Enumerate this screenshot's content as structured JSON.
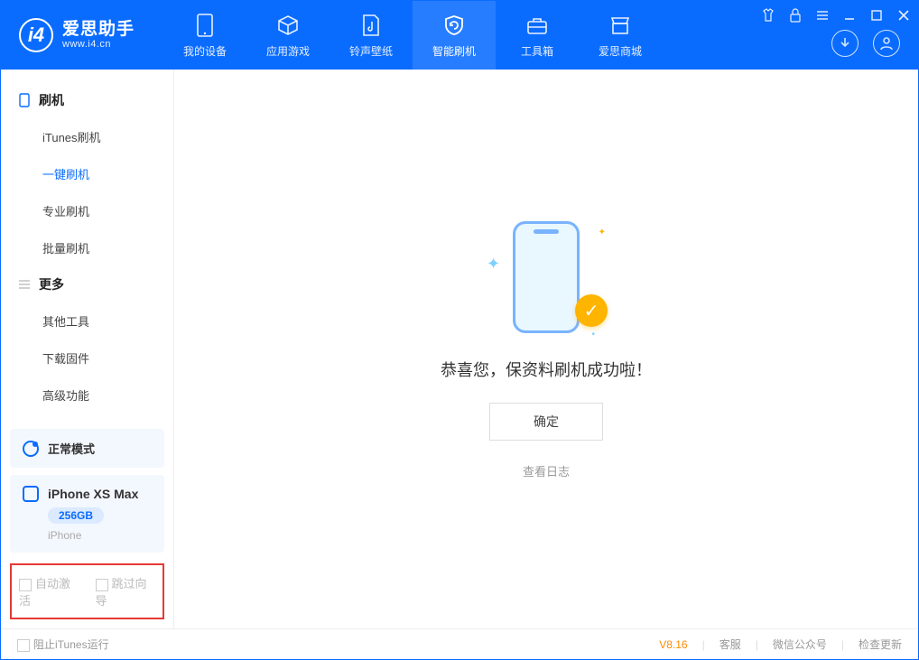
{
  "app": {
    "name": "爱思助手",
    "url": "www.i4.cn"
  },
  "topnav": {
    "items": [
      {
        "label": "我的设备"
      },
      {
        "label": "应用游戏"
      },
      {
        "label": "铃声壁纸"
      },
      {
        "label": "智能刷机"
      },
      {
        "label": "工具箱"
      },
      {
        "label": "爱思商城"
      }
    ],
    "active_index": 3
  },
  "sidebar": {
    "group1": {
      "title": "刷机",
      "items": [
        "iTunes刷机",
        "一键刷机",
        "专业刷机",
        "批量刷机"
      ],
      "active_index": 1
    },
    "group2": {
      "title": "更多",
      "items": [
        "其他工具",
        "下载固件",
        "高级功能"
      ]
    }
  },
  "mode": {
    "label": "正常模式"
  },
  "device": {
    "name": "iPhone XS Max",
    "storage": "256GB",
    "type": "iPhone"
  },
  "options": {
    "auto_activate": "自动激活",
    "skip_guide": "跳过向导"
  },
  "main": {
    "success": "恭喜您，保资料刷机成功啦！",
    "ok": "确定",
    "view_log": "查看日志"
  },
  "status": {
    "block_itunes": "阻止iTunes运行",
    "version": "V8.16",
    "support": "客服",
    "wechat": "微信公众号",
    "check_update": "检查更新"
  }
}
